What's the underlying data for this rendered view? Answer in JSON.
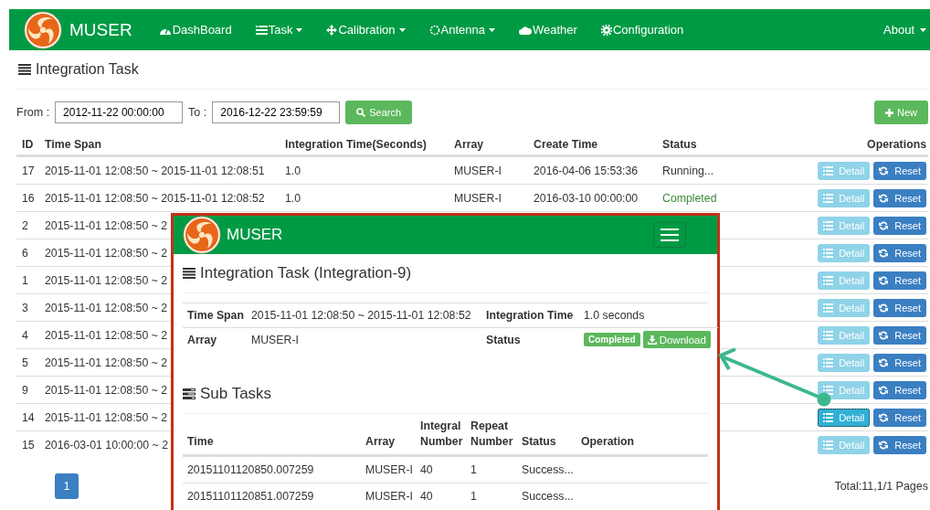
{
  "navbar": {
    "brand": "MUSER",
    "items": [
      {
        "label": "DashBoard",
        "dropdown": false
      },
      {
        "label": "Task",
        "dropdown": true
      },
      {
        "label": "Calibration",
        "dropdown": true
      },
      {
        "label": "Antenna",
        "dropdown": true
      },
      {
        "label": "Weather",
        "dropdown": false
      },
      {
        "label": "Configuration",
        "dropdown": false
      }
    ],
    "about": {
      "label": "About",
      "dropdown": true
    }
  },
  "page": {
    "title": "Integration Task",
    "filter": {
      "from_label": "From :",
      "from": "2012-11-22 00:00:00",
      "to_label": "To :",
      "to": "2016-12-22 23:59:59",
      "search_button": "Search"
    },
    "new_button": "New",
    "table": {
      "columns": [
        "ID",
        "Time Span",
        "Integration Time(Seconds)",
        "Array",
        "Create Time",
        "Status",
        "Operations"
      ],
      "rows": [
        {
          "id": "17",
          "time_span": "2015-11-01 12:08:50 ~ 2015-11-01 12:08:51",
          "integration_time": "1.0",
          "array": "MUSER-I",
          "create_time": "2016-04-06 15:53:36",
          "status": {
            "text": "Running...",
            "kind": "running"
          },
          "detail": "Detail",
          "reset": "Reset",
          "highlighted": false
        },
        {
          "id": "16",
          "time_span": "2015-11-01 12:08:50 ~ 2015-11-01 12:08:52",
          "integration_time": "1.0",
          "array": "MUSER-I",
          "create_time": "2016-03-10 00:00:00",
          "status": {
            "text": "Completed",
            "kind": "completed"
          },
          "detail": "Detail",
          "reset": "Reset",
          "highlighted": false
        },
        {
          "id": "2",
          "time_span": "2015-11-01 12:08:50 ~ 2",
          "detail": "Detail",
          "reset": "Reset",
          "highlighted": false
        },
        {
          "id": "6",
          "time_span": "2015-11-01 12:08:50 ~ 2",
          "detail": "Detail",
          "reset": "Reset",
          "highlighted": false
        },
        {
          "id": "1",
          "time_span": "2015-11-01 12:08:50 ~ 2",
          "detail": "Detail",
          "reset": "Reset",
          "highlighted": false
        },
        {
          "id": "3",
          "time_span": "2015-11-01 12:08:50 ~ 2",
          "detail": "Detail",
          "reset": "Reset",
          "highlighted": false
        },
        {
          "id": "4",
          "time_span": "2015-11-01 12:08:50 ~ 2",
          "detail": "Detail",
          "reset": "Reset",
          "highlighted": false
        },
        {
          "id": "5",
          "time_span": "2015-11-01 12:08:50 ~ 2",
          "detail": "Detail",
          "reset": "Reset",
          "highlighted": false
        },
        {
          "id": "9",
          "time_span": "2015-11-01 12:08:50 ~ 2",
          "detail": "Detail",
          "reset": "Reset",
          "highlighted": false
        },
        {
          "id": "14",
          "time_span": "2015-11-01 12:08:50 ~ 2",
          "detail": "Detail",
          "reset": "Reset",
          "highlighted": true
        },
        {
          "id": "15",
          "time_span": "2016-03-01 10:00:00 ~ 2",
          "detail": "Detail",
          "reset": "Reset",
          "highlighted": false
        }
      ]
    },
    "pagination": {
      "pages": [
        {
          "label": "1",
          "selected": true
        }
      ],
      "total": "Total:11,1/1 Pages"
    }
  },
  "popup": {
    "brand": "MUSER",
    "title": "Integration Task (Integration-9)",
    "detail": {
      "time_span_label": "Time Span",
      "time_span": "2015-11-01 12:08:50 ~ 2015-11-01 12:08:52",
      "integration_time_label": "Integration Time",
      "integration_time": "1.0 seconds",
      "array_label": "Array",
      "array": "MUSER-I",
      "status_label": "Status",
      "status_badge": {
        "text": "Completed",
        "kind": "completed"
      },
      "download_button": "Download"
    },
    "sub_tasks": {
      "title": "Sub Tasks",
      "columns": [
        [
          "Time"
        ],
        [
          "Array"
        ],
        [
          "Integral",
          "Number"
        ],
        [
          "Repeat",
          "Number"
        ],
        [
          "Status"
        ],
        [
          "Operation"
        ]
      ],
      "rows": [
        {
          "time": "20151101120850.007259",
          "array": "MUSER-I",
          "integral_number": "40",
          "repeat_number": "1",
          "status": "Success..."
        },
        {
          "time": "20151101120851.007259",
          "array": "MUSER-I",
          "integral_number": "40",
          "repeat_number": "1",
          "status": "Success..."
        }
      ]
    }
  }
}
